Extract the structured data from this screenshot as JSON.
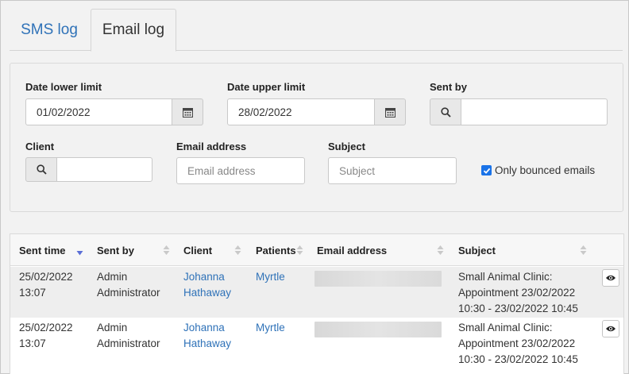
{
  "tabs": [
    {
      "label": "SMS log",
      "active": false
    },
    {
      "label": "Email log",
      "active": true
    }
  ],
  "filters": {
    "date_lower": {
      "label": "Date lower limit",
      "value": "01/02/2022"
    },
    "date_upper": {
      "label": "Date upper limit",
      "value": "28/02/2022"
    },
    "sent_by": {
      "label": "Sent by",
      "value": ""
    },
    "client": {
      "label": "Client",
      "value": ""
    },
    "email": {
      "label": "Email address",
      "placeholder": "Email address"
    },
    "subject": {
      "label": "Subject",
      "placeholder": "Subject"
    },
    "only_bounced": {
      "label": "Only bounced emails",
      "checked": true
    }
  },
  "table": {
    "columns": [
      "Sent time",
      "Sent by",
      "Client",
      "Patients",
      "Email address",
      "Subject"
    ],
    "sort_column": "Sent time",
    "sort_direction": "descending",
    "rows": [
      {
        "sent_time_date": "25/02/2022",
        "sent_time_time": "13:07",
        "sent_by_1": "Admin",
        "sent_by_2": "Administrator",
        "client_1": "Johanna",
        "client_2": "Hathaway",
        "patient": "Myrtle",
        "email": "",
        "subject_1": "Small Animal Clinic:",
        "subject_2": "Appointment 23/02/2022",
        "subject_3": "10:30 - 23/02/2022 10:45"
      },
      {
        "sent_time_date": "25/02/2022",
        "sent_time_time": "13:07",
        "sent_by_1": "Admin",
        "sent_by_2": "Administrator",
        "client_1": "Johanna",
        "client_2": "Hathaway",
        "patient": "Myrtle",
        "email": "",
        "subject_1": "Small Animal Clinic:",
        "subject_2": "Appointment 23/02/2022",
        "subject_3": "10:30 - 23/02/2022 10:45"
      }
    ]
  },
  "icons": {
    "calendar": "calendar-icon",
    "search": "search-icon",
    "view": "eye-icon",
    "sort": "sort-arrows-icon"
  },
  "colors": {
    "link": "#2f72b8",
    "sort_active": "#5b6fd6",
    "checkbox": "#1a73e8"
  }
}
